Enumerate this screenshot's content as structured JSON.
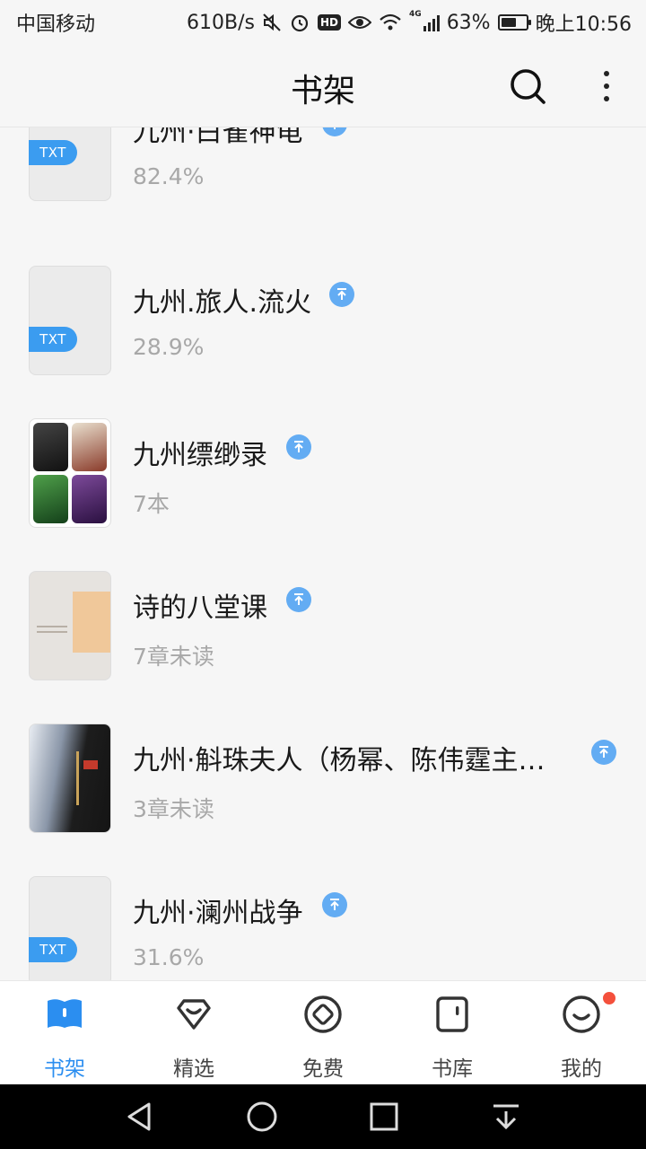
{
  "status_bar": {
    "carrier": "中国移动",
    "speed": "610B/s",
    "hd": "HD",
    "network": "4G",
    "battery_percent": "63%",
    "battery_level": 0.63,
    "time": "晚上10:56"
  },
  "header": {
    "title": "书架",
    "search_icon": "search-icon",
    "more_icon": "more-vertical-icon"
  },
  "books": [
    {
      "title": "九州·白雀神龟",
      "subtitle": "82.4%",
      "cover": "txt",
      "badge": "TXT"
    },
    {
      "title": "九州.旅人.流火",
      "subtitle": "28.9%",
      "cover": "txt",
      "badge": "TXT"
    },
    {
      "title": "九州缥缈录",
      "subtitle": "7本",
      "cover": "collection"
    },
    {
      "title": "诗的八堂课",
      "subtitle": "7章未读",
      "cover": "image"
    },
    {
      "title": "九州·斛珠夫人（杨幂、陈伟霆主…",
      "subtitle": "3章未读",
      "cover": "image"
    },
    {
      "title": "九州·澜州战争",
      "subtitle": "31.6%",
      "cover": "txt",
      "badge": "TXT"
    }
  ],
  "bottom_nav": [
    {
      "label": "书架",
      "icon": "bookshelf-icon",
      "active": true
    },
    {
      "label": "精选",
      "icon": "featured-heart-icon",
      "active": false
    },
    {
      "label": "免费",
      "icon": "free-coin-icon",
      "active": false
    },
    {
      "label": "书库",
      "icon": "library-icon",
      "active": false
    },
    {
      "label": "我的",
      "icon": "profile-smile-icon",
      "active": false,
      "notification": true
    }
  ],
  "colors": {
    "accent": "#2b8ef0",
    "badge_blue": "#3b9cf0",
    "up_icon": "#63acf3",
    "notification": "#f4503c"
  }
}
